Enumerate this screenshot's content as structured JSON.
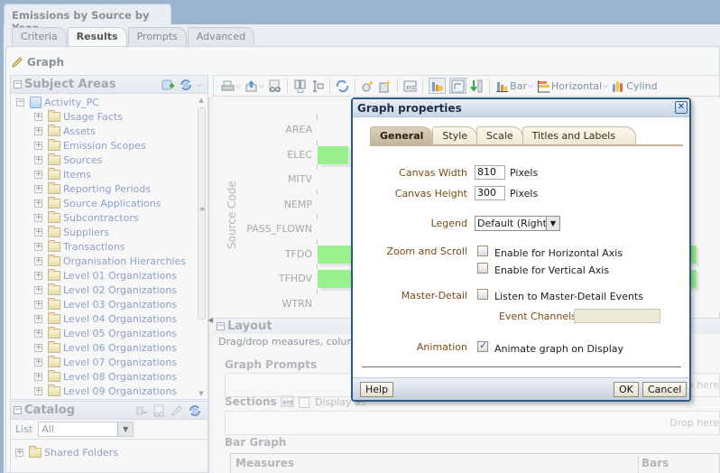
{
  "window": {
    "title": "Emissions by Source by Year"
  },
  "tabs": [
    {
      "label": "Criteria",
      "active": false
    },
    {
      "label": "Results",
      "active": true
    },
    {
      "label": "Prompts",
      "active": false
    },
    {
      "label": "Advanced",
      "active": false
    }
  ],
  "view": {
    "title": "Graph"
  },
  "subject_areas": {
    "title": "Subject Areas",
    "root": "Activity_PC",
    "items": [
      "Usage Facts",
      "Assets",
      "Emission Scopes",
      "Sources",
      "Items",
      "Reporting Periods",
      "Source Applications",
      "Subcontractors",
      "Suppliers",
      "Transactions",
      "Organisation Hierarchies",
      "Level 01 Organizations",
      "Level 02 Organizations",
      "Level 03 Organizations",
      "Level 04 Organizations",
      "Level 05 Organizations",
      "Level 06 Organizations",
      "Level 07 Organizations",
      "Level 08 Organizations",
      "Level 09 Organizations"
    ]
  },
  "catalog": {
    "title": "Catalog",
    "list_label": "List",
    "list_value": "All",
    "items": [
      "Shared Folders"
    ]
  },
  "toolbar": {
    "graph_type": "Bar",
    "orientation": "Horizontal",
    "style": "Cylind"
  },
  "chart_data": {
    "type": "bar",
    "orientation": "horizontal",
    "ylabel": "Source Code",
    "categories": [
      "AREA",
      "ELEC",
      "MITV",
      "NEMP",
      "PASS_FLOWN",
      "TFDO",
      "TFHDV",
      "WTRN"
    ],
    "values_note": "bar lengths partially hidden behind dialog; relative visible extents",
    "has_bar": [
      false,
      true,
      false,
      false,
      false,
      true,
      true,
      false
    ],
    "bar_color": "#98f08e"
  },
  "layout": {
    "title": "Layout",
    "description": "Drag/drop measures, columns",
    "graph_prompts": "Graph Prompts",
    "sections": "Sections",
    "display_as": "Display as",
    "drop_here": "Drop here",
    "bar_graph": "Bar Graph",
    "measures": "Measures",
    "bars": "Bars"
  },
  "dialog": {
    "title": "Graph properties",
    "tabs": [
      {
        "label": "General",
        "active": true
      },
      {
        "label": "Style",
        "active": false
      },
      {
        "label": "Scale",
        "active": false
      },
      {
        "label": "Titles and Labels",
        "active": false
      }
    ],
    "canvas_width_label": "Canvas Width",
    "canvas_width": "810",
    "canvas_height_label": "Canvas Height",
    "canvas_height": "300",
    "unit": "Pixels",
    "legend_label": "Legend",
    "legend_value": "Default (Right)",
    "zoom_label": "Zoom and Scroll",
    "zoom_h": {
      "label": "Enable for Horizontal Axis",
      "checked": false
    },
    "zoom_v": {
      "label": "Enable for Vertical Axis",
      "checked": false
    },
    "master_label": "Master-Detail",
    "master": {
      "label": "Listen to Master-Detail Events",
      "checked": false
    },
    "event_channels_label": "Event Channels",
    "event_channels": "",
    "animation_label": "Animation",
    "animation": {
      "label": "Animate graph on Display",
      "checked": true
    },
    "help": "Help",
    "ok": "OK",
    "cancel": "Cancel"
  }
}
